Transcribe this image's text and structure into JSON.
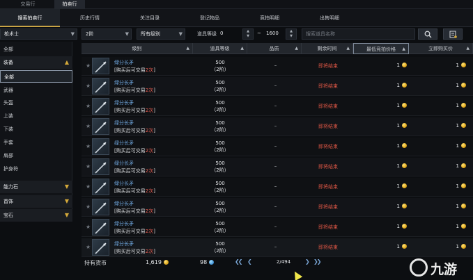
{
  "top_tabs": [
    {
      "label": "交易行",
      "active": false
    },
    {
      "label": "拍卖行",
      "active": true
    }
  ],
  "sub_tabs": [
    {
      "label": "搜索拍卖行",
      "active": true
    },
    {
      "label": "历史行情",
      "active": false
    },
    {
      "label": "关注目录",
      "active": false
    },
    {
      "label": "登记物品",
      "active": false
    },
    {
      "label": "竞拍明细",
      "active": false
    },
    {
      "label": "出售明细",
      "active": false
    }
  ],
  "filters": {
    "class_value": "枪术士",
    "tier_value": "2阶",
    "grade_value": "所有级别",
    "item_level_label": "道具等级",
    "level_min": "0",
    "level_sep": "~",
    "level_max": "1600",
    "search_placeholder": "搜索道具名称",
    "search_value": ""
  },
  "sidebar": {
    "items": [
      {
        "label": "全部",
        "type": "item",
        "expanded": false
      },
      {
        "label": "装备",
        "type": "category",
        "expanded": true
      },
      {
        "label": "全部",
        "type": "item",
        "selected": true
      },
      {
        "label": "武器",
        "type": "item"
      },
      {
        "label": "头盔",
        "type": "item"
      },
      {
        "label": "上装",
        "type": "item"
      },
      {
        "label": "下装",
        "type": "item"
      },
      {
        "label": "手套",
        "type": "item"
      },
      {
        "label": "肩部",
        "type": "item"
      },
      {
        "label": "护身符",
        "type": "item"
      },
      {
        "label": "能力石",
        "type": "category",
        "expanded": false
      },
      {
        "label": "首饰",
        "type": "category",
        "expanded": false
      },
      {
        "label": "宝石",
        "type": "category",
        "expanded": false
      }
    ]
  },
  "table": {
    "columns": [
      {
        "label": "级别",
        "sortable": true
      },
      {
        "label": "道具等级",
        "sortable": true
      },
      {
        "label": "品质",
        "sortable": true
      },
      {
        "label": "剩余时间",
        "sortable": true
      },
      {
        "label": "最低竞拍价格",
        "sortable": true,
        "highlighted": true
      },
      {
        "label": "立即购买价",
        "sortable": true
      }
    ],
    "rows": [
      {
        "name": "绿分长矛",
        "note_prefix": "[购买后可交易",
        "note_count": "2次",
        "note_suffix": "]",
        "item_level": "500",
        "tier": "（2阶）",
        "quality": "–",
        "time_left": "即将结束",
        "min_bid": "1",
        "buy_now": "1"
      },
      {
        "name": "绿分长矛",
        "note_prefix": "[购买后可交易",
        "note_count": "2次",
        "note_suffix": "]",
        "item_level": "500",
        "tier": "（2阶）",
        "quality": "–",
        "time_left": "即将结束",
        "min_bid": "1",
        "buy_now": "1"
      },
      {
        "name": "绿分长矛",
        "note_prefix": "[购买后可交易",
        "note_count": "2次",
        "note_suffix": "]",
        "item_level": "500",
        "tier": "（2阶）",
        "quality": "–",
        "time_left": "即将结束",
        "min_bid": "1",
        "buy_now": "1"
      },
      {
        "name": "绿分长矛",
        "note_prefix": "[购买后可交易",
        "note_count": "2次",
        "note_suffix": "]",
        "item_level": "500",
        "tier": "（2阶）",
        "quality": "–",
        "time_left": "即将结束",
        "min_bid": "1",
        "buy_now": "1"
      },
      {
        "name": "绿分长矛",
        "note_prefix": "[购买后可交易",
        "note_count": "2次",
        "note_suffix": "]",
        "item_level": "500",
        "tier": "（2阶）",
        "quality": "–",
        "time_left": "即将结束",
        "min_bid": "1",
        "buy_now": "1"
      },
      {
        "name": "绿分长矛",
        "note_prefix": "[购买后可交易",
        "note_count": "2次",
        "note_suffix": "]",
        "item_level": "500",
        "tier": "（2阶）",
        "quality": "–",
        "time_left": "即将结束",
        "min_bid": "1",
        "buy_now": "1"
      },
      {
        "name": "绿分长矛",
        "note_prefix": "[购买后可交易",
        "note_count": "2次",
        "note_suffix": "]",
        "item_level": "500",
        "tier": "（2阶）",
        "quality": "–",
        "time_left": "即将结束",
        "min_bid": "1",
        "buy_now": "1"
      },
      {
        "name": "绿分长矛",
        "note_prefix": "[购买后可交易",
        "note_count": "2次",
        "note_suffix": "]",
        "item_level": "500",
        "tier": "（2阶）",
        "quality": "–",
        "time_left": "即将结束",
        "min_bid": "1",
        "buy_now": "1"
      },
      {
        "name": "绿分长矛",
        "note_prefix": "[购买后可交易",
        "note_count": "2次",
        "note_suffix": "]",
        "item_level": "500",
        "tier": "（2阶）",
        "quality": "–",
        "time_left": "即将结束",
        "min_bid": "1",
        "buy_now": "1"
      },
      {
        "name": "绿分长矛",
        "note_prefix": "[购买后可交易",
        "note_count": "2次",
        "note_suffix": "]",
        "item_level": "500",
        "tier": "（2阶）",
        "quality": "–",
        "time_left": "即将结束",
        "min_bid": "1",
        "buy_now": "1"
      }
    ]
  },
  "footer": {
    "currency_label": "持有货币",
    "gold": "1,619",
    "gems": "98",
    "page_text": "2/494"
  },
  "watermark": {
    "text": "九游"
  },
  "icons": {
    "search": "search-icon",
    "settings": "list-settings-icon",
    "coin": "gold-coin-icon",
    "gem": "blue-gem-icon",
    "favorite": "star-icon",
    "spear": "spear-icon"
  },
  "colors": {
    "accent_gold": "#c9a445",
    "time_red": "#d75443",
    "item_blue": "#6fa7df"
  }
}
